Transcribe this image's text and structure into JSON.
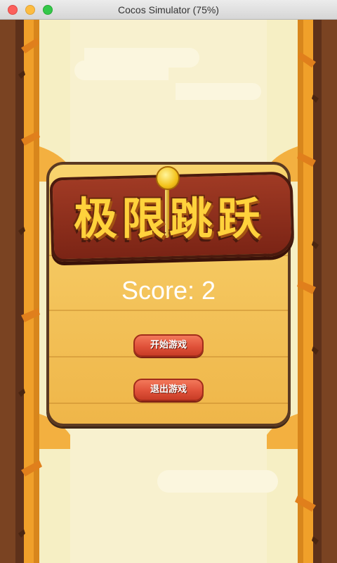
{
  "window": {
    "title": "Cocos Simulator (75%)"
  },
  "game": {
    "logo_text": "极限跳跃",
    "score_label": "Score: 2",
    "score_value": 2,
    "buttons": {
      "start": "开始游戏",
      "exit": "退出游戏"
    }
  },
  "colors": {
    "tree_trunk": "#6b3a1e",
    "tree_orange": "#f0a02a",
    "background": "#f6efc4",
    "panel": "#f3c259",
    "button": "#e0523a"
  }
}
